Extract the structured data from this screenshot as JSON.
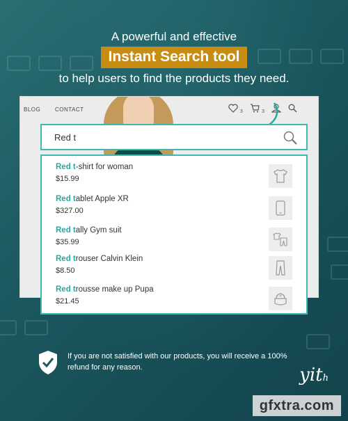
{
  "headline": {
    "line1": "A powerful and effective",
    "highlight": "Instant Search tool",
    "line3": "to help users to find the products they need."
  },
  "site": {
    "nav": [
      "BLOG",
      "CONTACT"
    ],
    "icons": [
      "heart-icon",
      "cart-icon",
      "user-icon",
      "search-icon"
    ],
    "wishlist_count": "3",
    "cart_count": "3"
  },
  "search": {
    "value": "Red t",
    "accent_color": "#3fb8b0"
  },
  "results": [
    {
      "match": "Red t",
      "rest": "-shirt for woman",
      "price": "$15.99",
      "icon": "tshirt-icon"
    },
    {
      "match": "Red t",
      "rest": "ablet Apple XR",
      "price": "$327.00",
      "icon": "tablet-icon"
    },
    {
      "match": "Red t",
      "rest": "ally Gym suit",
      "price": "$35.99",
      "icon": "gym-suit-icon"
    },
    {
      "match": "Red t",
      "rest": "rouser Calvin Klein",
      "price": "$8.50",
      "icon": "trousers-icon"
    },
    {
      "match": "Red t",
      "rest": "rousse make up Pupa",
      "price": "$21.45",
      "icon": "makeup-icon"
    }
  ],
  "guarantee": {
    "text": "If you are not satisfied with our products, you will receive a 100% refund for any reason."
  },
  "brand": {
    "logo": "yith",
    "highlight_color": "#c98c12"
  },
  "watermark": "gfxtra.com"
}
